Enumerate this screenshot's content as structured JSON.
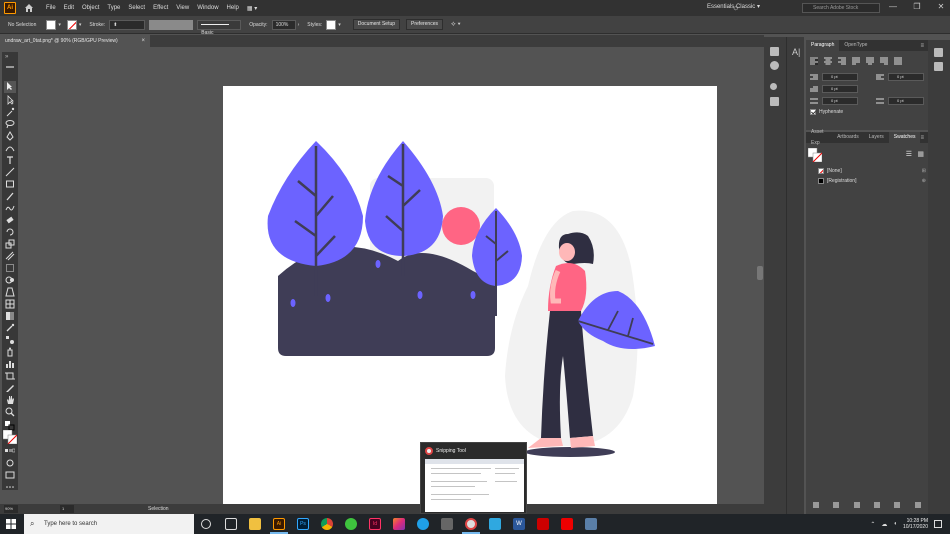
{
  "app": {
    "logo": "Ai",
    "name": "Adobe Illustrator"
  },
  "menu": {
    "items": [
      "File",
      "Edit",
      "Object",
      "Type",
      "Select",
      "Effect",
      "View",
      "Window",
      "Help"
    ],
    "workspace": "Essentials Classic",
    "search_placeholder": "Search Adobe Stock"
  },
  "control_bar": {
    "selection_label": "No Selection",
    "stroke_label": "Stroke:",
    "stroke_style": "Basic",
    "opacity_label": "Opacity:",
    "opacity_value": "100%",
    "styles_label": "Styles:",
    "document_setup": "Document Setup",
    "preferences": "Preferences"
  },
  "document": {
    "tab_title": "undraw_art_0tat.png* @ 90% (RGB/GPU Preview)",
    "close": "×"
  },
  "status_bar": {
    "zoom": "90%",
    "artboard_number": "1",
    "current_tool": "Selection"
  },
  "paragraph_panel": {
    "tabs": [
      "Paragraph",
      "OpenType"
    ],
    "indent_values": [
      "0 pt",
      "0 pt",
      "0 pt",
      "0 pt",
      "0 pt"
    ],
    "hyphenate_label": "Hyphenate"
  },
  "swatches_panel": {
    "tabs": [
      "Asset Exp",
      "Artboards",
      "Layers",
      "Swatches"
    ],
    "items": [
      "[None]",
      "[Registration]"
    ]
  },
  "snipping_popup": {
    "title": "Snipping Tool"
  },
  "taskbar": {
    "search_placeholder": "Type here to search",
    "time": "10:28 PM",
    "date": "10/17/2020"
  },
  "colors": {
    "accent_purple": "#6c63ff",
    "dark_shape": "#3f3d56",
    "sun_pink": "#ff6584",
    "light_gray": "#f2f2f2"
  }
}
